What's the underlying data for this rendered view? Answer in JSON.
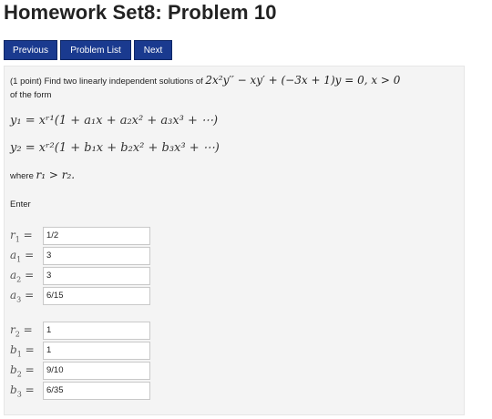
{
  "page": {
    "title": "Homework Set8: Problem 10"
  },
  "nav": {
    "previous": "Previous",
    "problem_list": "Problem List",
    "next": "Next"
  },
  "problem": {
    "intro_text": "(1 point) Find two linearly independent solutions of",
    "equation": "2x²y′′ − xy′ + (−3x + 1)y = 0, x > 0",
    "form_text": "of the form",
    "series1": "y₁ = xʳ¹(1 + a₁x + a₂x² + a₃x³ + ⋯)",
    "series2": "y₂ = xʳ²(1 + b₁x + b₂x² + b₃x³ + ⋯)",
    "where_text": "where",
    "where_math": "r₁ > r₂.",
    "enter_text": "Enter"
  },
  "answers": [
    {
      "sym": "r",
      "sub": "1",
      "value": "1/2"
    },
    {
      "sym": "a",
      "sub": "1",
      "value": "3"
    },
    {
      "sym": "a",
      "sub": "2",
      "value": "3"
    },
    {
      "sym": "a",
      "sub": "3",
      "value": "6/15"
    },
    {
      "sym": "r",
      "sub": "2",
      "value": "1"
    },
    {
      "sym": "b",
      "sub": "1",
      "value": "1"
    },
    {
      "sym": "b",
      "sub": "2",
      "value": "9/10"
    },
    {
      "sym": "b",
      "sub": "3",
      "value": "6/35"
    }
  ],
  "eq_sign": "="
}
